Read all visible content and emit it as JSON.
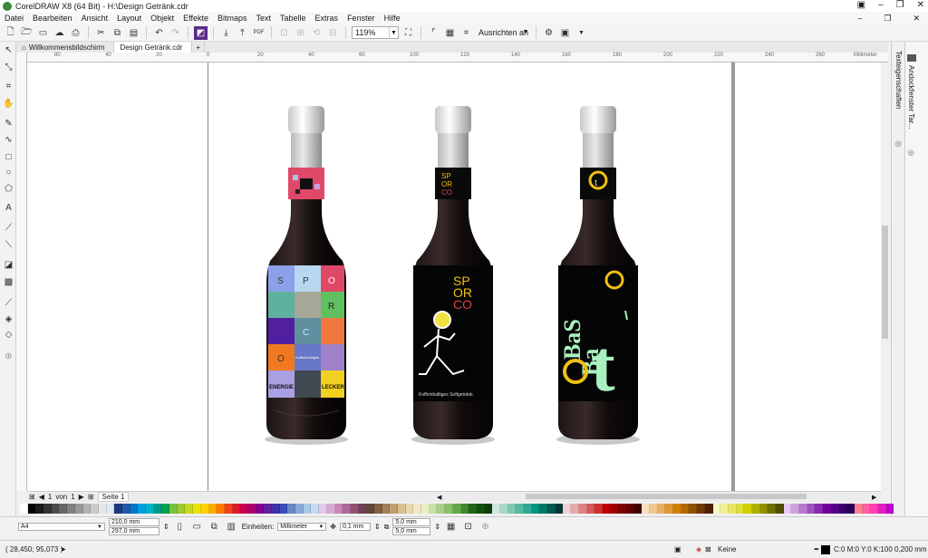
{
  "window": {
    "title": "CorelDRAW X8 (64 Bit) - H:\\Design Getränk.cdr"
  },
  "menu": [
    "Datei",
    "Bearbeiten",
    "Ansicht",
    "Layout",
    "Objekt",
    "Effekte",
    "Bitmaps",
    "Text",
    "Tabelle",
    "Extras",
    "Fenster",
    "Hilfe"
  ],
  "toolbar": {
    "zoom": "119%",
    "snap_label": "Ausrichten an",
    "pdf_label": "PDF"
  },
  "tabs": [
    "Willkommensbildschirm",
    "Design Getränk.cdr"
  ],
  "ruler": {
    "unit": "Millimeter",
    "ticks": [
      "80",
      "60",
      "40",
      "20",
      "0",
      "20",
      "40",
      "60",
      "80",
      "100",
      "120",
      "140",
      "160",
      "180",
      "200",
      "220",
      "240",
      "260",
      "280"
    ]
  },
  "dockers": [
    "Texteigenschaften",
    "Andockfenster Tar..."
  ],
  "pages": {
    "current": "1",
    "of_label": "von",
    "total": "1",
    "tab": "Seite 1"
  },
  "properties": {
    "paper": "A4",
    "width": "210,0 mm",
    "height": "297,0 mm",
    "units_label": "Einheiten:",
    "units": "Millimeter",
    "nudge": "0,1 mm",
    "dup_x": "5,0 mm",
    "dup_y": "5,0 mm"
  },
  "status": {
    "coords": "( 28,450; 95,073 )",
    "fill_label": "Keine",
    "outline": "C:0 M:0 Y:0 K:100  0,200 mm"
  },
  "bottles": {
    "b1": {
      "labels": [
        "ENERGIE",
        "LECKER",
        "Koffeinhaltiges"
      ],
      "letters": [
        "S",
        "P",
        "O",
        "R",
        "C",
        "O"
      ]
    },
    "b2": {
      "brand": [
        "SP",
        "OR",
        "CO"
      ],
      "tagline": "Koffeinhaltiges Softgetränk"
    },
    "b3": {
      "big": "BaS",
      "big2": "Ba",
      "big3": "t"
    }
  },
  "palette": [
    "#ffffff",
    "#000000",
    "#1a1a1a",
    "#333333",
    "#4d4d4d",
    "#666666",
    "#808080",
    "#999999",
    "#b3b3b3",
    "#cccccc",
    "#e6e6e6",
    "#e0e8f0",
    "#1a3a7a",
    "#2456a8",
    "#0078c8",
    "#00a0e0",
    "#00b4c8",
    "#009a88",
    "#00a050",
    "#78c040",
    "#a0c830",
    "#c8d820",
    "#f0e000",
    "#ffd000",
    "#ffa800",
    "#ff7800",
    "#f04020",
    "#e01830",
    "#c80050",
    "#a80070",
    "#800090",
    "#6020a0",
    "#4030a8",
    "#3850b8",
    "#6888c8",
    "#88a8d8",
    "#a8c8e8",
    "#c8d8f0",
    "#e0c8e8",
    "#d8a8d0",
    "#c888b8",
    "#b06898",
    "#905070",
    "#704058",
    "#604838",
    "#806040",
    "#a08058",
    "#c0a070",
    "#d8c090",
    "#e8d8b0",
    "#f0e8c8",
    "#e8f0c8",
    "#c8e0a8",
    "#a8d088",
    "#88c068",
    "#60a848",
    "#408830",
    "#206818",
    "#105010",
    "#084008",
    "#d0e8e0",
    "#a8d8c8",
    "#80c8b0",
    "#58b8a0",
    "#30a890",
    "#009880",
    "#007868",
    "#005850",
    "#003838",
    "#f0d0d0",
    "#e8a8a8",
    "#e08080",
    "#d85858",
    "#d03030",
    "#c00000",
    "#a00000",
    "#800000",
    "#600000",
    "#400000",
    "#f8e0c0",
    "#f0c890",
    "#e8b060",
    "#e09830",
    "#d08000",
    "#b06800",
    "#905000",
    "#703800",
    "#502000",
    "#f8f8c0",
    "#f0f090",
    "#e8e860",
    "#e0e030",
    "#d0d000",
    "#b0b000",
    "#909000",
    "#707000",
    "#505000",
    "#e8c8f0",
    "#d0a0e0",
    "#b878d0",
    "#a050c0",
    "#8828b0",
    "#7000a0",
    "#580088",
    "#400070",
    "#280058",
    "#ff8090",
    "#ff60a0",
    "#ff40b0",
    "#e020c0",
    "#c000d0"
  ]
}
